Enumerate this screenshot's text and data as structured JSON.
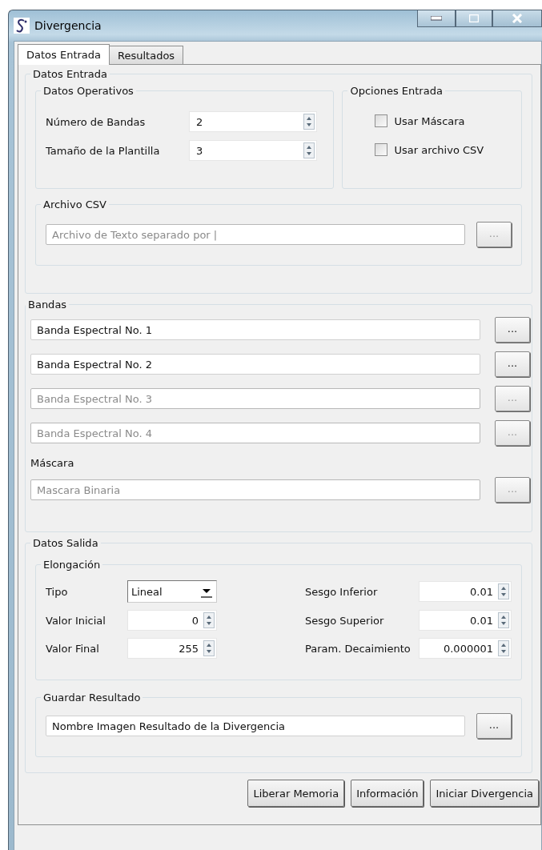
{
  "window": {
    "title": "Divergencia"
  },
  "tabs": [
    {
      "label": "Datos Entrada",
      "selected": true
    },
    {
      "label": "Resultados",
      "selected": false
    }
  ],
  "datos_entrada": {
    "title": "Datos Entrada",
    "datos_operativos": {
      "title": "Datos Operativos",
      "fields": [
        {
          "label": "Número de Bandas",
          "value": "2"
        },
        {
          "label": "Tamaño de la Plantilla",
          "value": "3"
        }
      ]
    },
    "opciones_entrada": {
      "title": "Opciones Entrada",
      "options": [
        {
          "label": "Usar Máscara",
          "checked": false
        },
        {
          "label": "Usar archivo CSV",
          "checked": false
        }
      ]
    },
    "archivo_csv": {
      "title": "Archivo CSV",
      "field": {
        "value": "Archivo de Texto separado por |",
        "disabled": true
      },
      "button": "..."
    }
  },
  "bandas": {
    "title": "Bandas",
    "fields": [
      {
        "value": "Banda Espectral No. 1",
        "disabled": false,
        "button": "..."
      },
      {
        "value": "Banda Espectral No. 2",
        "disabled": false,
        "button": "..."
      },
      {
        "value": "Banda Espectral No. 3",
        "disabled": true,
        "button": "..."
      },
      {
        "value": "Banda Espectral No. 4",
        "disabled": true,
        "button": "..."
      }
    ],
    "mascara": {
      "label": "Máscara",
      "value": "Mascara Binaria",
      "disabled": true,
      "button": "..."
    }
  },
  "datos_salida": {
    "title": "Datos Salida",
    "elongacion": {
      "title": "Elongación",
      "left": [
        {
          "kind": "select",
          "label": "Tipo",
          "value": "Lineal"
        },
        {
          "kind": "spin",
          "label": "Valor Inicial",
          "value": "0"
        },
        {
          "kind": "spin",
          "label": "Valor Final",
          "value": "255"
        }
      ],
      "right": [
        {
          "kind": "spin",
          "label": "Sesgo Inferior",
          "value": "0.01"
        },
        {
          "kind": "spin",
          "label": "Sesgo Superior",
          "value": "0.01"
        },
        {
          "kind": "spin",
          "label": "Param. Decaimiento",
          "value": "0.000001"
        }
      ]
    },
    "guardar_resultado": {
      "title": "Guardar Resultado",
      "field": {
        "value": "Nombre Imagen Resultado de la Divergencia",
        "disabled": false
      },
      "button": "..."
    }
  },
  "buttons": [
    "Liberar Memoria",
    "Información",
    "Iniciar Divergencia"
  ]
}
